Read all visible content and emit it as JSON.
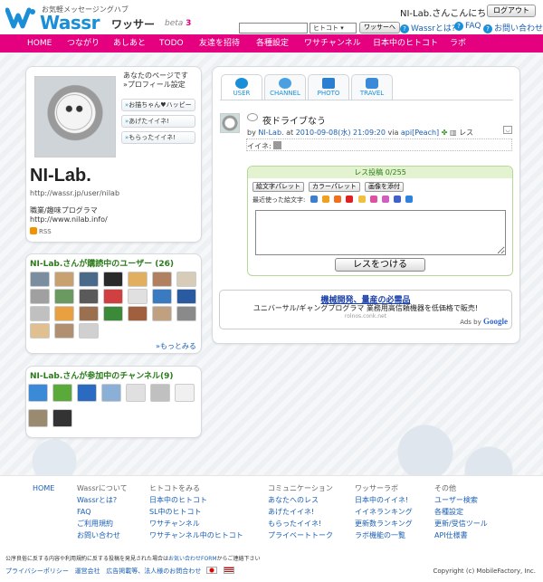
{
  "header": {
    "logo_tagline": "お気軽メッセージングハブ",
    "logo_word": "Wassr",
    "logo_kana": "ワッサー",
    "logo_beta": "beta",
    "logo_beta_num": "3",
    "greeting": "NI-Lab.さんこんにちは!",
    "logout_label": "ログアウト",
    "search_placeholder": "",
    "search_scope": "ヒトコト",
    "search_button": "ワッサーへ",
    "links": [
      "Wassrとは?",
      "FAQ",
      "お問い合わせ"
    ]
  },
  "nav": {
    "items": [
      "HOME",
      "つながり",
      "あしあと",
      "TODO",
      "友達を招待",
      "各種設定",
      "ワサチャンネル",
      "日本中のヒトコト",
      "ラボ"
    ]
  },
  "profile": {
    "note_line1": "あなたのページです",
    "note_line2": "»プロフィール設定",
    "buttons": [
      "お描ちゃん♥ハッピー",
      "あげたイイネ!",
      "もらったイイネ!"
    ],
    "name": "NI-Lab.",
    "url": "http://wassr.jp/user/nilab",
    "bio_line1": "職業/趣味プログラマ",
    "bio_line2": "http://www.nilab.info/",
    "rss": "RSS"
  },
  "following": {
    "title": "NI-Lab.さんが購読中のユーザー (26)",
    "more": "»もっとみる"
  },
  "channels": {
    "title": "NI-Lab.さんが参加中のチャンネル(9)"
  },
  "tabs": [
    "USER",
    "CHANNEL",
    "PHOTO",
    "TRAVEL"
  ],
  "post": {
    "text": "夜ドライブなう",
    "author": "NI-Lab.",
    "at": "at",
    "datetime": "2010-09-08(水) 21:09:20",
    "via": "via",
    "client": "api[Peach]",
    "reply": "レス",
    "iine_label": "イイネ:"
  },
  "reply_form": {
    "header": "レス投稿 0/255",
    "emoji_button": "絵文字パレット",
    "color_button": "カラーパレット",
    "image_button": "画像を添付",
    "recent_label": "最近使った絵文字:",
    "submit": "レスをつける"
  },
  "ad": {
    "title": "機械開発、量産の必需品",
    "body": "ユニバーサル/ギャングプログラマ 業務用高信頼機器を低価格で販売!",
    "url": "rolnos.conk.net",
    "by": "Ads by",
    "google": "Google"
  },
  "footer": {
    "columns": [
      {
        "head": "HOME",
        "links": []
      },
      {
        "head": "Wassrについて",
        "links": [
          "Wassrとは?",
          "FAQ",
          "ご利用規約",
          "お問い合わせ"
        ]
      },
      {
        "head": "ヒトコトをみる",
        "links": [
          "日本中のヒトコト",
          "SL中のヒトコト",
          "ワサチャンネル",
          "ワサチャンネル中のヒトコト"
        ]
      },
      {
        "head": "コミュニケーション",
        "links": [
          "あなたへのレス",
          "あげたイイネ!",
          "もらったイイネ!",
          "プライベートトーク"
        ]
      },
      {
        "head": "ワッサーラボ",
        "links": [
          "日本中のイイネ!",
          "イイネランキング",
          "更新数ランキング",
          "ラボ機能の一覧"
        ]
      },
      {
        "head": "その他",
        "links": [
          "ユーザー検索",
          "各種設定",
          "更新/受信ツール",
          "API仕様書"
        ]
      }
    ],
    "legal_text": "公序良俗に反する内容や利用規約に反する投稿を発見された場合は",
    "legal_link": "お気い合わせFORM",
    "legal_tail": "からご連絡下さい",
    "bottom_links": [
      "プライバシーポリシー",
      "運営会社",
      "広告掲載等、法人様のお問合わせ"
    ],
    "copyright": "Copyright (c) MobileFactory, Inc."
  },
  "colors": {
    "brand_pink": "#e4007f",
    "brand_blue": "#1a8fd8",
    "box_title_green": "#2a7a1a"
  }
}
